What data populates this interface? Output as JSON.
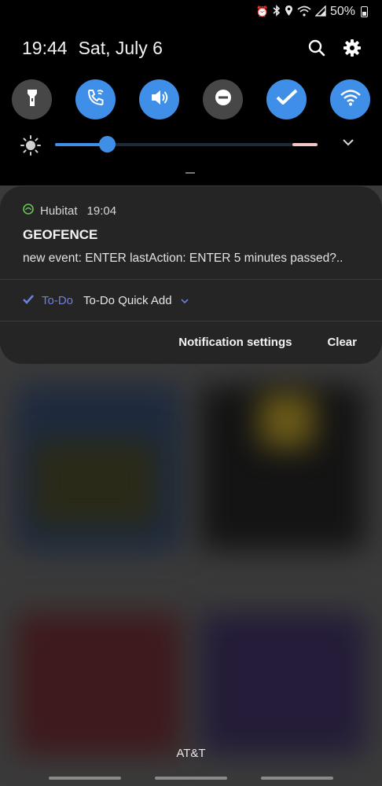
{
  "status_bar": {
    "battery_percent": "50%",
    "icons": [
      "alarm-icon",
      "bluetooth-icon",
      "location-icon",
      "wifi-icon",
      "signal-icon",
      "battery-icon"
    ]
  },
  "header": {
    "time": "19:44",
    "date": "Sat, July 6",
    "icons": [
      "search-icon",
      "gear-icon"
    ]
  },
  "quick_settings": [
    {
      "name": "flashlight",
      "icon": "flashlight-icon",
      "active": false
    },
    {
      "name": "wifi-calling",
      "icon": "wifi-calling-icon",
      "active": true
    },
    {
      "name": "sound",
      "icon": "volume-icon",
      "active": true
    },
    {
      "name": "do-not-disturb",
      "icon": "dnd-icon",
      "active": false
    },
    {
      "name": "todo",
      "icon": "checkmark-icon",
      "active": true
    },
    {
      "name": "wifi",
      "icon": "wifi-icon",
      "active": true
    }
  ],
  "brightness": {
    "level": 0.2,
    "icons": [
      "sun-icon",
      "chevron-down-icon"
    ]
  },
  "notification": {
    "app_name": "Hubitat",
    "time": "19:04",
    "title": "GEOFENCE",
    "body": "new event: ENTER lastAction: ENTER 5 minutes passed?..",
    "action_app": "To-Do",
    "action_label": "To-Do Quick Add",
    "settings_label": "Notification settings",
    "clear_label": "Clear",
    "colors": {
      "app_icon": "#6bc05b",
      "todo": "#6f7fe0"
    }
  },
  "carrier": "AT&T",
  "colors": {
    "accent": "#3f8fe8",
    "card": "#252525"
  }
}
